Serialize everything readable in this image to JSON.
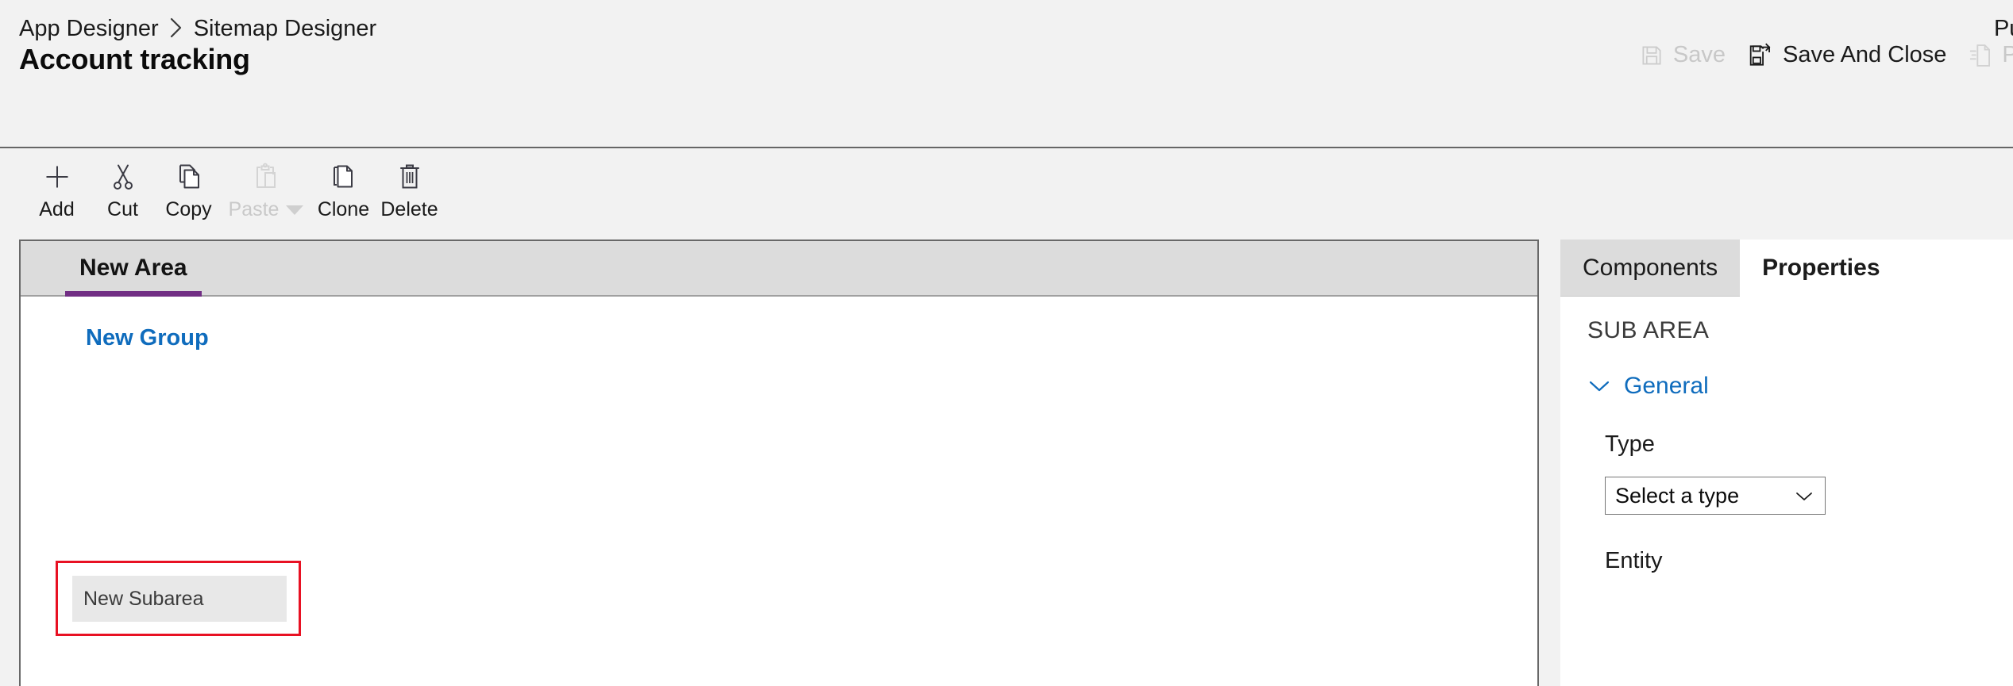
{
  "header": {
    "breadcrumb": {
      "root": "App Designer",
      "separator_icon": "chevron-right-icon",
      "current": "Sitemap Designer"
    },
    "title": "Account tracking",
    "status": "Publ",
    "commands": [
      {
        "id": "save",
        "label": "Save",
        "icon": "save-icon",
        "disabled": true
      },
      {
        "id": "save-and-close",
        "label": "Save And Close",
        "icon": "save-and-close-icon",
        "disabled": false
      },
      {
        "id": "publish",
        "label": "Pub",
        "icon": "publish-icon",
        "disabled": true
      }
    ]
  },
  "toolbar": {
    "buttons": [
      {
        "id": "add",
        "label": "Add",
        "icon": "plus-icon",
        "disabled": false,
        "has_menu": false
      },
      {
        "id": "cut",
        "label": "Cut",
        "icon": "scissors-icon",
        "disabled": false,
        "has_menu": false
      },
      {
        "id": "copy",
        "label": "Copy",
        "icon": "copy-icon",
        "disabled": false,
        "has_menu": false
      },
      {
        "id": "paste",
        "label": "Paste",
        "icon": "clipboard-icon",
        "disabled": true,
        "has_menu": true
      },
      {
        "id": "clone",
        "label": "Clone",
        "icon": "clone-icon",
        "disabled": false,
        "has_menu": false
      },
      {
        "id": "delete",
        "label": "Delete",
        "icon": "trash-icon",
        "disabled": false,
        "has_menu": false
      }
    ]
  },
  "canvas": {
    "area_tabs": [
      {
        "id": "new-area",
        "label": "New Area",
        "active": true
      }
    ],
    "group": {
      "title": "New Group",
      "subareas": [
        {
          "id": "new-subarea",
          "label": "New Subarea",
          "selected": true
        }
      ]
    }
  },
  "panel": {
    "tabs": [
      {
        "id": "components",
        "label": "Components",
        "active": false
      },
      {
        "id": "properties",
        "label": "Properties",
        "active": true
      }
    ],
    "heading": "SUB AREA",
    "sections": [
      {
        "id": "general",
        "title": "General",
        "expanded": true,
        "chevron_icon": "chevron-down-icon",
        "fields": [
          {
            "id": "type",
            "label": "Type",
            "control": "select",
            "value": "Select a type",
            "chevron_icon": "chevron-down-icon"
          },
          {
            "id": "entity",
            "label": "Entity",
            "control": "select",
            "value": ""
          }
        ]
      }
    ]
  },
  "colors": {
    "accent_purple": "#712e84",
    "link_blue": "#0f6cbd",
    "selection_red": "#e81123",
    "app_background": "#f2f2f2",
    "tab_strip": "#dcdcdc",
    "tile_grey": "#e8e8e8"
  }
}
